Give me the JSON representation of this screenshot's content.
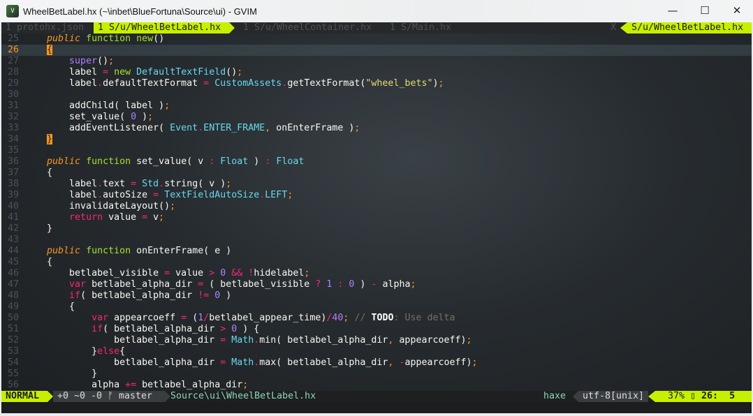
{
  "window": {
    "title": "WheelBetLabel.hx (~\\inbet\\BlueFortuna\\Source\\ui) - GVIM",
    "minimize": "—",
    "maximize": "☐",
    "close": "✕"
  },
  "tabline": {
    "tabs": [
      "1 protohx.json",
      "1 S/u/WheelBetLabel.hx",
      "1 S/u/WheelContainer.hx",
      "1 S/Main.hx"
    ],
    "close": "X",
    "right": "S/u/WheelBetLabel.hx"
  },
  "colors": {
    "accent": "#c7ef00"
  },
  "current_line": 26,
  "lines": [
    {
      "n": "25",
      "s": [
        [
          "",
          "    "
        ],
        [
          "it",
          "public"
        ],
        [
          "",
          " "
        ],
        [
          "g",
          "function"
        ],
        [
          "",
          " "
        ],
        [
          "g",
          "new"
        ],
        [
          "",
          "()"
        ]
      ]
    },
    {
      "n": "26",
      "s": [
        [
          "",
          "    "
        ],
        [
          "br",
          "{"
        ]
      ]
    },
    {
      "n": "27",
      "s": [
        [
          "",
          "        "
        ],
        [
          "n",
          "super"
        ],
        [
          "",
          "()"
        ],
        [
          "o",
          ";"
        ]
      ]
    },
    {
      "n": "28",
      "s": [
        [
          "",
          "        label "
        ],
        [
          "k",
          "="
        ],
        [
          "",
          " "
        ],
        [
          "g",
          "new"
        ],
        [
          "",
          " "
        ],
        [
          "t",
          "DefaultTextField"
        ],
        [
          "",
          "()"
        ],
        [
          "o",
          ";"
        ]
      ]
    },
    {
      "n": "29",
      "s": [
        [
          "",
          "        label"
        ],
        [
          "k",
          "."
        ],
        [
          "",
          "defaultTextFormat "
        ],
        [
          "k",
          "="
        ],
        [
          "",
          " "
        ],
        [
          "t",
          "CustomAssets"
        ],
        [
          "k",
          "."
        ],
        [
          "",
          "getTextFormat("
        ],
        [
          "s",
          "\"wheel_bets\""
        ],
        [
          "",
          ")"
        ],
        [
          "o",
          ";"
        ]
      ]
    },
    {
      "n": "30",
      "s": []
    },
    {
      "n": "31",
      "s": [
        [
          "",
          "        addChild( label )"
        ],
        [
          "o",
          ";"
        ]
      ]
    },
    {
      "n": "32",
      "s": [
        [
          "",
          "        set_value( "
        ],
        [
          "n",
          "0"
        ],
        [
          "",
          " )"
        ],
        [
          "o",
          ";"
        ]
      ]
    },
    {
      "n": "33",
      "s": [
        [
          "",
          "        addEventListener( "
        ],
        [
          "t",
          "Event"
        ],
        [
          "k",
          "."
        ],
        [
          "t",
          "ENTER_FRAME"
        ],
        [
          "o",
          ","
        ],
        [
          "",
          " onEnterFrame )"
        ],
        [
          "o",
          ";"
        ]
      ]
    },
    {
      "n": "34",
      "s": [
        [
          "",
          "    "
        ],
        [
          "br",
          "}"
        ]
      ]
    },
    {
      "n": "35",
      "s": []
    },
    {
      "n": "36",
      "s": [
        [
          "",
          "    "
        ],
        [
          "it",
          "public"
        ],
        [
          "",
          " "
        ],
        [
          "g",
          "function"
        ],
        [
          "",
          " set_value( v "
        ],
        [
          "k",
          ":"
        ],
        [
          "",
          " "
        ],
        [
          "t",
          "Float"
        ],
        [
          "",
          " ) "
        ],
        [
          "k",
          ":"
        ],
        [
          "",
          " "
        ],
        [
          "t",
          "Float"
        ]
      ]
    },
    {
      "n": "37",
      "s": [
        [
          "",
          "    {"
        ]
      ]
    },
    {
      "n": "38",
      "s": [
        [
          "",
          "        label"
        ],
        [
          "k",
          "."
        ],
        [
          "",
          "text "
        ],
        [
          "k",
          "="
        ],
        [
          "",
          " "
        ],
        [
          "t",
          "Std"
        ],
        [
          "k",
          "."
        ],
        [
          "",
          "string( v )"
        ],
        [
          "o",
          ";"
        ]
      ]
    },
    {
      "n": "39",
      "s": [
        [
          "",
          "        label"
        ],
        [
          "k",
          "."
        ],
        [
          "",
          "autoSize "
        ],
        [
          "k",
          "="
        ],
        [
          "",
          " "
        ],
        [
          "t",
          "TextFieldAutoSize"
        ],
        [
          "k",
          "."
        ],
        [
          "t",
          "LEFT"
        ],
        [
          "o",
          ";"
        ]
      ]
    },
    {
      "n": "40",
      "s": [
        [
          "",
          "        invalidateLayout()"
        ],
        [
          "o",
          ";"
        ]
      ]
    },
    {
      "n": "41",
      "s": [
        [
          "",
          "        "
        ],
        [
          "k",
          "return"
        ],
        [
          "",
          " value "
        ],
        [
          "k",
          "="
        ],
        [
          "",
          " v"
        ],
        [
          "o",
          ";"
        ]
      ]
    },
    {
      "n": "42",
      "s": [
        [
          "",
          "    }"
        ]
      ]
    },
    {
      "n": "43",
      "s": []
    },
    {
      "n": "44",
      "s": [
        [
          "",
          "    "
        ],
        [
          "it",
          "public"
        ],
        [
          "",
          " "
        ],
        [
          "g",
          "function"
        ],
        [
          "",
          " onEnterFrame( e )"
        ]
      ]
    },
    {
      "n": "45",
      "s": [
        [
          "",
          "    {"
        ]
      ]
    },
    {
      "n": "46",
      "s": [
        [
          "",
          "        betlabel_visible "
        ],
        [
          "k",
          "="
        ],
        [
          "",
          " value "
        ],
        [
          "k",
          ">"
        ],
        [
          "",
          " "
        ],
        [
          "n",
          "0"
        ],
        [
          "",
          " "
        ],
        [
          "k",
          "&&"
        ],
        [
          "",
          " "
        ],
        [
          "k",
          "!"
        ],
        [
          "",
          "hidelabel"
        ],
        [
          "o",
          ";"
        ]
      ]
    },
    {
      "n": "47",
      "s": [
        [
          "",
          "        "
        ],
        [
          "k",
          "var"
        ],
        [
          "",
          " betlabel_alpha_dir "
        ],
        [
          "k",
          "="
        ],
        [
          "",
          " ( betlabel_visible "
        ],
        [
          "k",
          "?"
        ],
        [
          "",
          " "
        ],
        [
          "n",
          "1"
        ],
        [
          "",
          " "
        ],
        [
          "k",
          ":"
        ],
        [
          "",
          " "
        ],
        [
          "n",
          "0"
        ],
        [
          "",
          " ) "
        ],
        [
          "k",
          "-"
        ],
        [
          "",
          " alpha"
        ],
        [
          "o",
          ";"
        ]
      ]
    },
    {
      "n": "48",
      "s": [
        [
          "",
          "        "
        ],
        [
          "k",
          "if"
        ],
        [
          "",
          "( betlabel_alpha_dir "
        ],
        [
          "k",
          "!="
        ],
        [
          "",
          " "
        ],
        [
          "n",
          "0"
        ],
        [
          "",
          " )"
        ]
      ]
    },
    {
      "n": "49",
      "s": [
        [
          "",
          "        {"
        ]
      ]
    },
    {
      "n": "50",
      "s": [
        [
          "",
          "            "
        ],
        [
          "k",
          "var"
        ],
        [
          "",
          " appearcoeff "
        ],
        [
          "k",
          "="
        ],
        [
          "",
          " ("
        ],
        [
          "n",
          "1"
        ],
        [
          "k",
          "/"
        ],
        [
          "",
          "betlabel_appear_time)"
        ],
        [
          "k",
          "/"
        ],
        [
          "n",
          "40"
        ],
        [
          "o",
          ";"
        ],
        [
          "",
          " "
        ],
        [
          "c",
          "// "
        ],
        [
          "b",
          "TODO"
        ],
        [
          "c",
          ": Use delta"
        ]
      ]
    },
    {
      "n": "51",
      "s": [
        [
          "",
          "            "
        ],
        [
          "k",
          "if"
        ],
        [
          "",
          "( betlabel_alpha_dir "
        ],
        [
          "k",
          ">"
        ],
        [
          "",
          " "
        ],
        [
          "n",
          "0"
        ],
        [
          "",
          " ) {"
        ]
      ]
    },
    {
      "n": "52",
      "s": [
        [
          "",
          "                betlabel_alpha_dir "
        ],
        [
          "k",
          "="
        ],
        [
          "",
          " "
        ],
        [
          "t",
          "Math"
        ],
        [
          "k",
          "."
        ],
        [
          "",
          "min( betlabel_alpha_dir"
        ],
        [
          "o",
          ","
        ],
        [
          "",
          " appearcoeff)"
        ],
        [
          "o",
          ";"
        ]
      ]
    },
    {
      "n": "53",
      "s": [
        [
          "",
          "            }"
        ],
        [
          "k",
          "else"
        ],
        [
          "",
          "{"
        ]
      ]
    },
    {
      "n": "54",
      "s": [
        [
          "",
          "                betlabel_alpha_dir "
        ],
        [
          "k",
          "="
        ],
        [
          "",
          " "
        ],
        [
          "t",
          "Math"
        ],
        [
          "k",
          "."
        ],
        [
          "",
          "max( betlabel_alpha_dir"
        ],
        [
          "o",
          ","
        ],
        [
          "",
          " "
        ],
        [
          "k",
          "-"
        ],
        [
          "",
          "appearcoeff)"
        ],
        [
          "o",
          ";"
        ]
      ]
    },
    {
      "n": "55",
      "s": [
        [
          "",
          "            }"
        ]
      ]
    },
    {
      "n": "56",
      "s": [
        [
          "",
          "            alpha "
        ],
        [
          "k",
          "+="
        ],
        [
          "",
          " betlabel_alpha_dir"
        ],
        [
          "o",
          ";"
        ]
      ]
    }
  ],
  "statusline": {
    "mode": "NORMAL",
    "git": "+0 ~0 -0 ᚠ master",
    "file": "Source\\ui\\WheelBetLabel.hx",
    "filetype": "haxe",
    "encoding": "utf-8[unix]",
    "percent": "37%",
    "pos_icon": "▯",
    "position": "26:  5"
  }
}
